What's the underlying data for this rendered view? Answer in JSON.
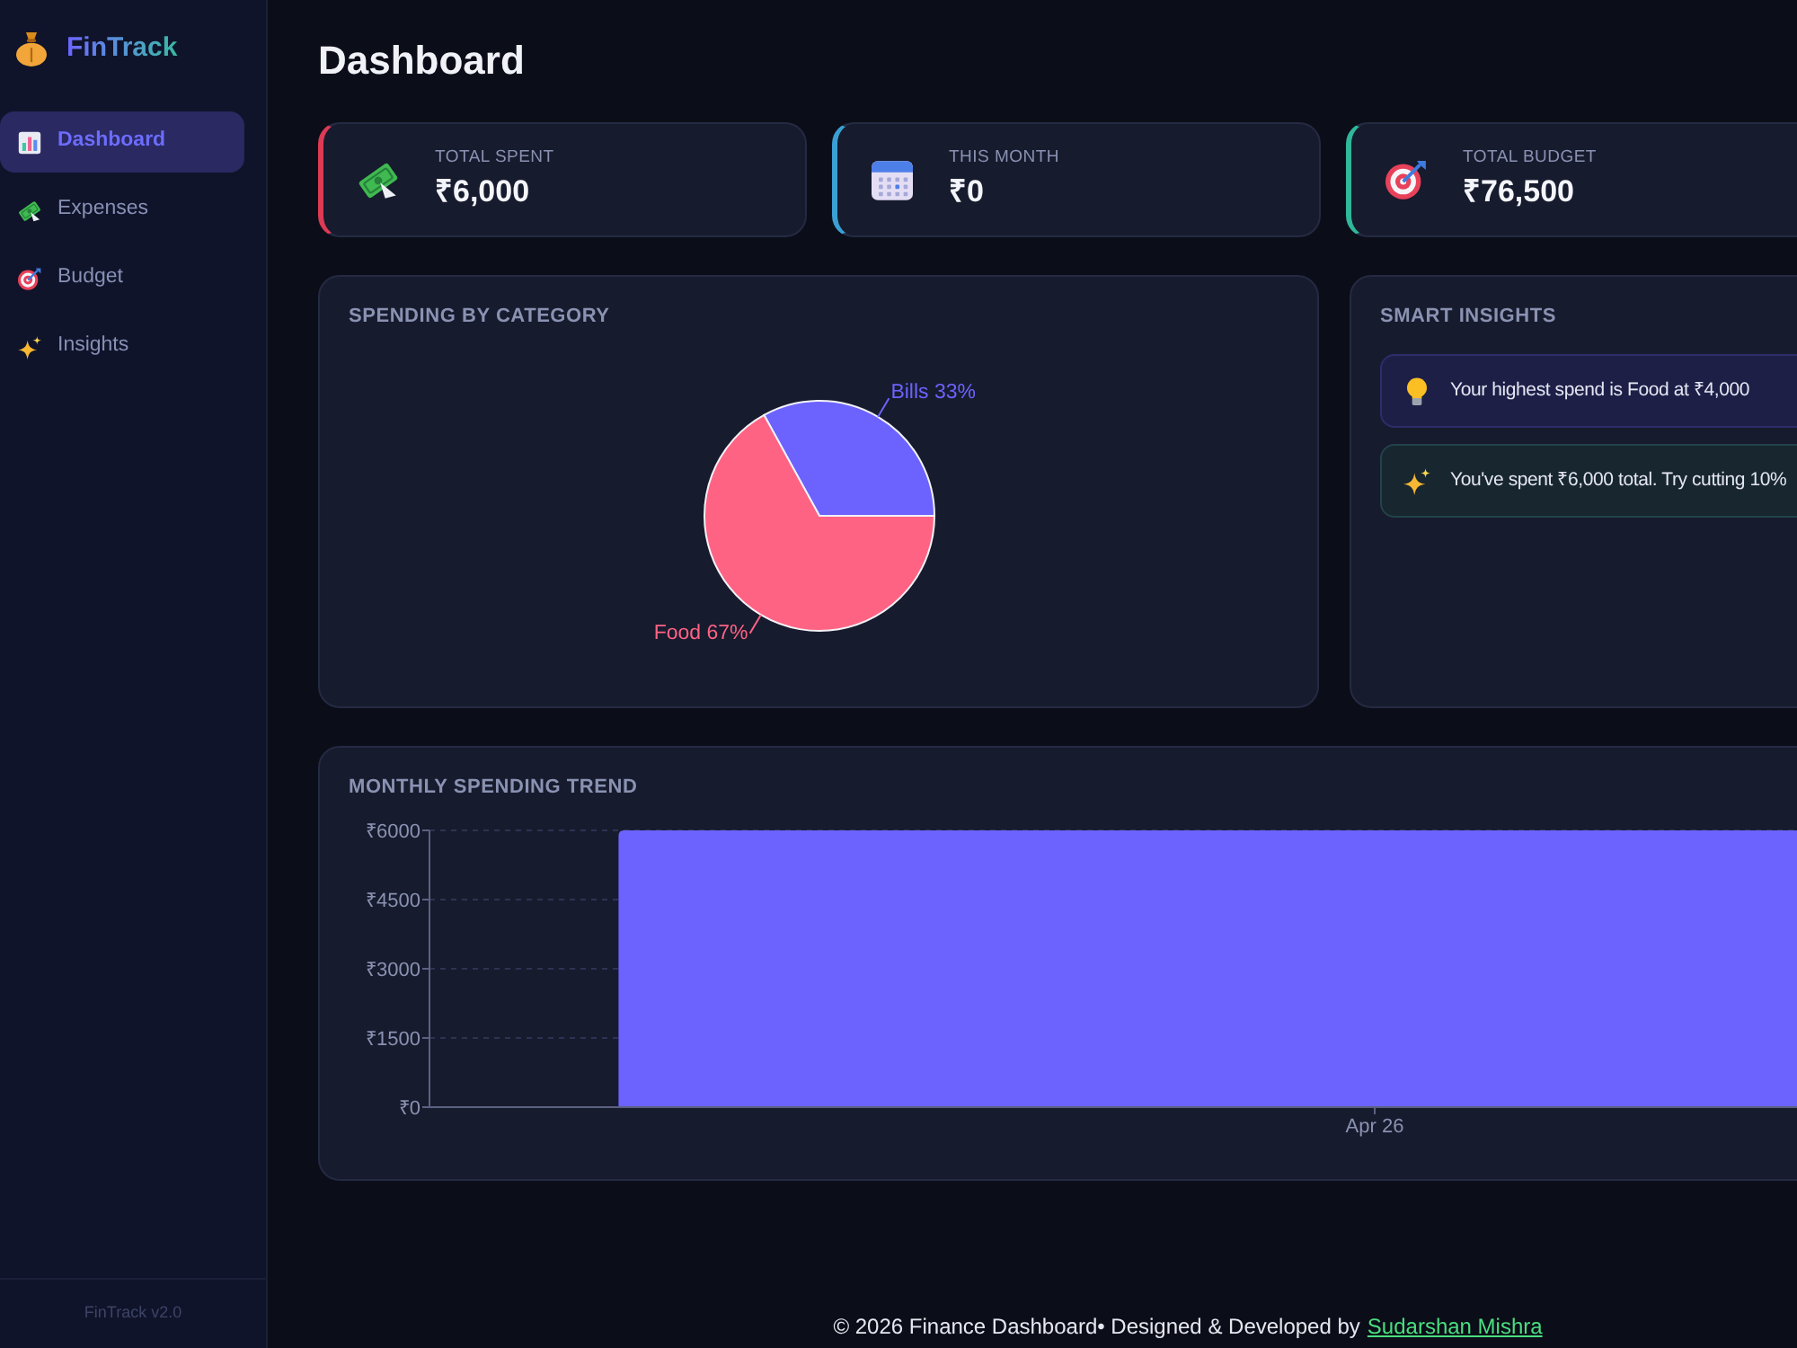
{
  "sidebar": {
    "logo": "FinTrack",
    "items": [
      {
        "label": "Dashboard",
        "selected": true
      },
      {
        "label": "Expenses",
        "selected": false
      },
      {
        "label": "Budget",
        "selected": false
      },
      {
        "label": "Insights",
        "selected": false
      }
    ],
    "version": "FinTrack v2.0"
  },
  "page_title": "Dashboard",
  "stat_cards": [
    {
      "label": "TOTAL SPENT",
      "value": "₹6,000",
      "color": "#dc3a55"
    },
    {
      "label": "THIS MONTH",
      "value": "₹0",
      "color": "#3aa0d4"
    },
    {
      "label": "TOTAL BUDGET",
      "value": "₹76,500",
      "color": "#2fb89a"
    }
  ],
  "spending_by_category": {
    "title": "SPENDING BY CATEGORY",
    "chart_data": {
      "type": "pie",
      "categories": [
        "Bills",
        "Food"
      ],
      "values": [
        33,
        67
      ],
      "colors": [
        "#6c63ff",
        "#ff6384"
      ],
      "value_labels": [
        "33%",
        "67%"
      ]
    }
  },
  "smart_insights": {
    "title": "SMART INSIGHTS",
    "items": [
      {
        "kind": "highlight",
        "text": "Your highest spend is Food at ₹4,000"
      },
      {
        "kind": "tip",
        "text": "You've spent ₹6,000 total. Try cutting 10%"
      }
    ]
  },
  "monthly_trend": {
    "title": "MONTHLY SPENDING TREND",
    "chart_data": {
      "type": "bar",
      "categories": [
        "Apr 26"
      ],
      "series": [
        {
          "color": "#6c63ff",
          "values": [
            6000
          ]
        }
      ],
      "ylim": [
        0,
        6000
      ],
      "yticks": [
        {
          "value": 0,
          "label": "₹0"
        },
        {
          "value": 1500,
          "label": "₹1500"
        },
        {
          "value": 3000,
          "label": "₹3000"
        },
        {
          "value": 4500,
          "label": "₹4500"
        },
        {
          "value": 6000,
          "label": "₹6000"
        }
      ],
      "grid": true
    }
  },
  "footer": {
    "text": "© 2026 Finance Dashboard• Designed & Developed by",
    "link": "Sudarshan Mishra"
  }
}
